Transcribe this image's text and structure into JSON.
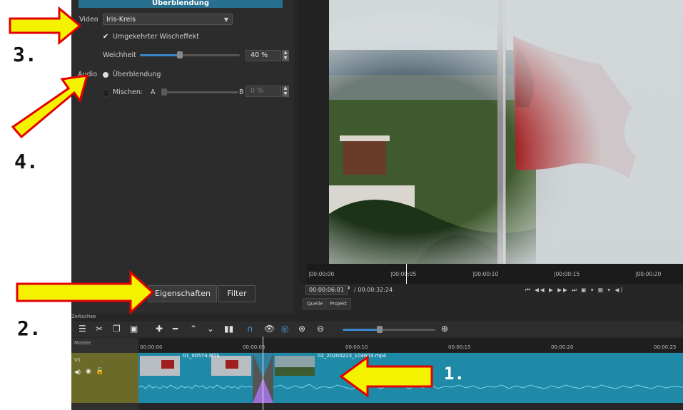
{
  "properties": {
    "title": "Überblendung",
    "video_label": "Video",
    "video_select_value": "Iris-Kreis",
    "invert_label": "Umgekehrter Wischeffekt",
    "softness_label": "Weichheit",
    "softness_value": "40 %",
    "softness_fraction": 0.4,
    "audio_label": "Audio",
    "crossfade_label": "Überblendung",
    "mix_label": "Mischen:",
    "mix_a": "A",
    "mix_b": "B",
    "mix_value": "0 %"
  },
  "panel_tabs": {
    "properties": "Eigenschaften",
    "filter": "Filter"
  },
  "player": {
    "ruler_ticks": [
      "|00:00:00",
      "|00:00:05",
      "|00:00:10",
      "|00:00:15",
      "|00:00:20"
    ],
    "current_time": "00:00:06:01",
    "total_time": "/ 00:00:32:24",
    "controls": "⏮ ◀◀ ▶ ▶▶ ⏭ ▣ ▾ ▦ ▾ ◀)",
    "source_tab": "Quelle",
    "project_tab": "Projekt"
  },
  "timeline": {
    "label": "Zeitachse",
    "master_label": "Master",
    "track_name": "V1",
    "ruler_ticks": [
      "00:00:00",
      "00:00:05",
      "00:00:10",
      "00:00:15",
      "00:00:20",
      "00:00:25"
    ],
    "clip1_name": "01_00574.MTS",
    "clip2_name": "02_20200223_104603.mp4"
  },
  "callouts": {
    "n1": "1.",
    "n2": "2.",
    "n3": "3.",
    "n4": "4."
  },
  "colors": {
    "accent_blue": "#27708f",
    "clip_blue": "#1e8aa8",
    "track_olive": "#6c6a28",
    "arrow_yellow": "#f5f200",
    "arrow_red": "#e30000"
  }
}
